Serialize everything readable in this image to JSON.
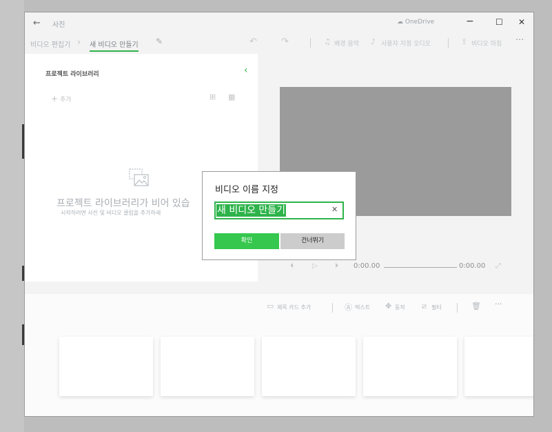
{
  "window": {
    "app_title": "사진",
    "onedrive_label": "OneDrive",
    "controls": {
      "minimize": "−",
      "maximize": "☐",
      "close": "✕"
    }
  },
  "toolbar": {
    "breadcrumb_parent": "비디오 편집기",
    "breadcrumb_current": "새 비디오 만들기",
    "background_music": "배경 음악",
    "custom_audio": "사용자 지정 오디오",
    "finish_video": "비디오 마침",
    "more": "···"
  },
  "library": {
    "title": "프로젝트 라이브러리",
    "add_label": "추가",
    "empty_title": "프로젝트 라이브러리가 비어 있습",
    "empty_hint": "시작하려면 사진 및 비디오 클립을 추가하세"
  },
  "playback": {
    "current_time": "0:00.00",
    "total_time": "0:00.00"
  },
  "storyboard": {
    "add_title_card": "제목 카드 추가",
    "text": "텍스트",
    "motion": "동작",
    "filters": "필터",
    "more": "···"
  },
  "dialog": {
    "title": "비디오 이름 지정",
    "name_value": "새 비디오 만들기",
    "ok_label": "확인",
    "skip_label": "건너뛰기"
  },
  "colors": {
    "accent": "#2db34a",
    "preview_bg": "#9b9b9b"
  }
}
